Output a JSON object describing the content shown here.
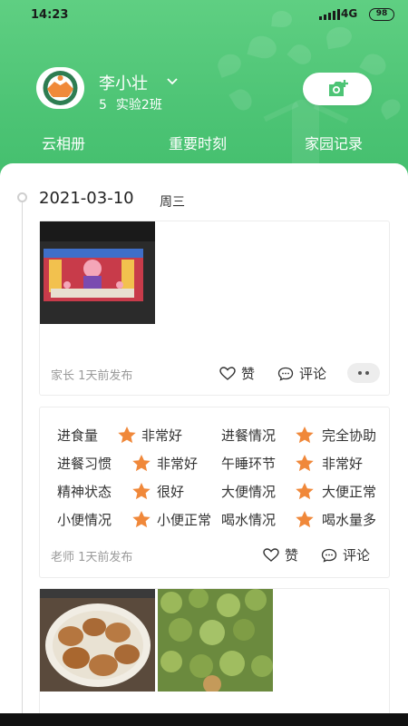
{
  "status_bar": {
    "time": "14:23",
    "network": "4G",
    "battery": "98"
  },
  "profile": {
    "name": "李小壮",
    "class_number": "5",
    "class_name": "实验2班"
  },
  "tabs": [
    "云相册",
    "重要时刻",
    "家园记录"
  ],
  "timeline": {
    "date": "2021-03-10",
    "weekday": "周三"
  },
  "post1": {
    "meta": "家长 1天前发布",
    "like_label": "赞",
    "comment_label": "评论"
  },
  "post2": {
    "meta": "老师 1天前发布",
    "like_label": "赞",
    "comment_label": "评论",
    "evaluations": [
      {
        "label": "进食量",
        "value": "非常好"
      },
      {
        "label": "进餐情况",
        "value": "完全协助"
      },
      {
        "label": "进餐习惯",
        "value": "非常好"
      },
      {
        "label": "午睡环节",
        "value": "非常好"
      },
      {
        "label": "精神状态",
        "value": "很好"
      },
      {
        "label": "大便情况",
        "value": "大便正常"
      },
      {
        "label": "小便情况",
        "value": "小便正常"
      },
      {
        "label": "喝水情况",
        "value": "喝水量多"
      }
    ]
  },
  "colors": {
    "brand_green": "#4dc475",
    "star_orange": "#f0883a",
    "avatar_orange": "#f08a3a",
    "avatar_green": "#2e7d52"
  },
  "icons": [
    "camera-plus-icon",
    "heart-icon",
    "comment-icon",
    "star-icon",
    "chevron-down-icon",
    "more-icon"
  ]
}
